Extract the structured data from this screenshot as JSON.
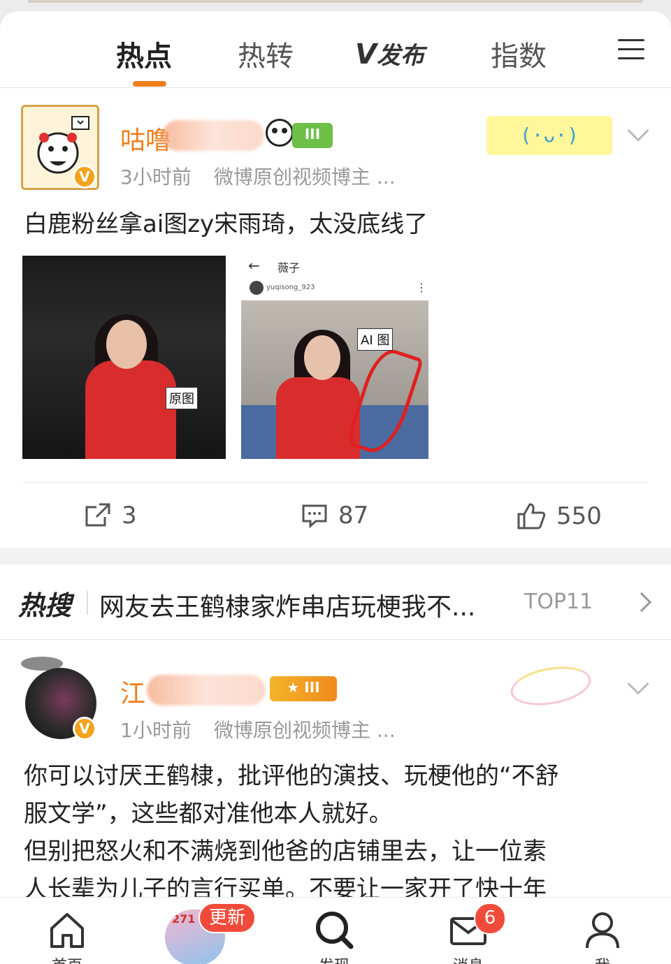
{
  "tabs": {
    "items": [
      {
        "label": "热点",
        "active": true
      },
      {
        "label": "热转",
        "active": false
      },
      {
        "label": "发布",
        "active": false
      },
      {
        "label": "指数",
        "active": false
      }
    ],
    "publish_logo_mark": "V",
    "accent_color": "#f07e1a"
  },
  "post1": {
    "username_visible": "咕噜",
    "level_badge": "III",
    "time": "3小时前",
    "source": "微博原创视频博主 ...",
    "deco_text": "(·ᴗ·)",
    "text": "白鹿粉丝拿ai图zy宋雨琦，太没底线了",
    "image1_label": "原图",
    "image2_label": "AI 图",
    "image2_title": "薇子",
    "image2_account": "yuqisong_923",
    "actions": {
      "repost": "3",
      "comment": "87",
      "like": "550"
    }
  },
  "hot_search": {
    "logo": "热搜",
    "text": "网友去王鹤棣家炸串店玩梗我不...",
    "rank": "TOP11"
  },
  "post2": {
    "username_visible": "江",
    "level_badge": "III",
    "time": "1小时前",
    "source": "微博原创视频博主 ...",
    "text_lines": [
      "你可以讨厌王鹤棣，批评他的演技、玩梗他的“不舒",
      "服文学”，这些都对准他本人就好。",
      "但别把怒火和不满烧到他爸的店铺里去，让一位素",
      "人长辈为儿子的言行买单。不要让一家开了快十年"
    ]
  },
  "bottom_nav": {
    "items": [
      {
        "label": "首页",
        "icon": "home-icon"
      },
      {
        "label": "",
        "icon": "video-thumb"
      },
      {
        "label": "发现",
        "icon": "search-icon"
      },
      {
        "label": "消息",
        "icon": "mail-icon"
      },
      {
        "label": "我",
        "icon": "user-icon"
      }
    ],
    "update_badge": "更新",
    "message_badge": "6",
    "thumb_number": "271"
  }
}
